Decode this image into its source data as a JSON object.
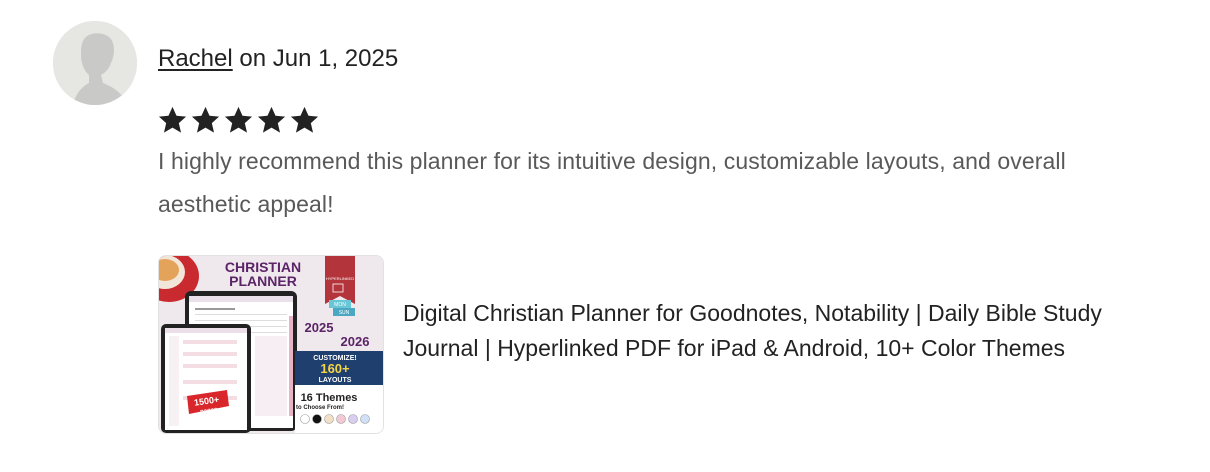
{
  "review": {
    "reviewer_name": "Rachel",
    "date_text": "on Jun 1, 2025",
    "rating": 5,
    "rating_max": 5,
    "text": "I highly recommend this planner for its intuitive design, customizable layouts, and overall aesthetic appeal!"
  },
  "product": {
    "title": "Digital Christian Planner for Goodnotes, Notability | Daily Bible Study Journal | Hyperlinked PDF for iPad & Android, 10+ Color Themes",
    "thumbnail": {
      "heading_line1": "CHRISTIAN",
      "heading_line2": "PLANNER",
      "ribbon_text": "HYPERLINKED",
      "mon_label": "MON",
      "sun_label": "SUN",
      "year_start": "2025",
      "year_end": "2026",
      "customize_label": "CUSTOMIZE!",
      "layouts_count": "160+",
      "layouts_label": "LAYOUTS",
      "themes_line1": "16 Themes",
      "themes_line2": "to Choose From!",
      "pages_count": "1500+",
      "pages_label": "pages",
      "theme_swatches": [
        "#ffffff",
        "#111111",
        "#f2e0c6",
        "#f4c9d6",
        "#d9cdf0",
        "#cfe0f7"
      ]
    }
  },
  "colors": {
    "star": "#222222",
    "review_text": "#595959",
    "heading_purple": "#5b2468",
    "ribbon_red": "#b3343b",
    "banner_navy": "#1f3f6e",
    "accent_yellow": "#f5d547",
    "badge_red": "#d8262b"
  }
}
